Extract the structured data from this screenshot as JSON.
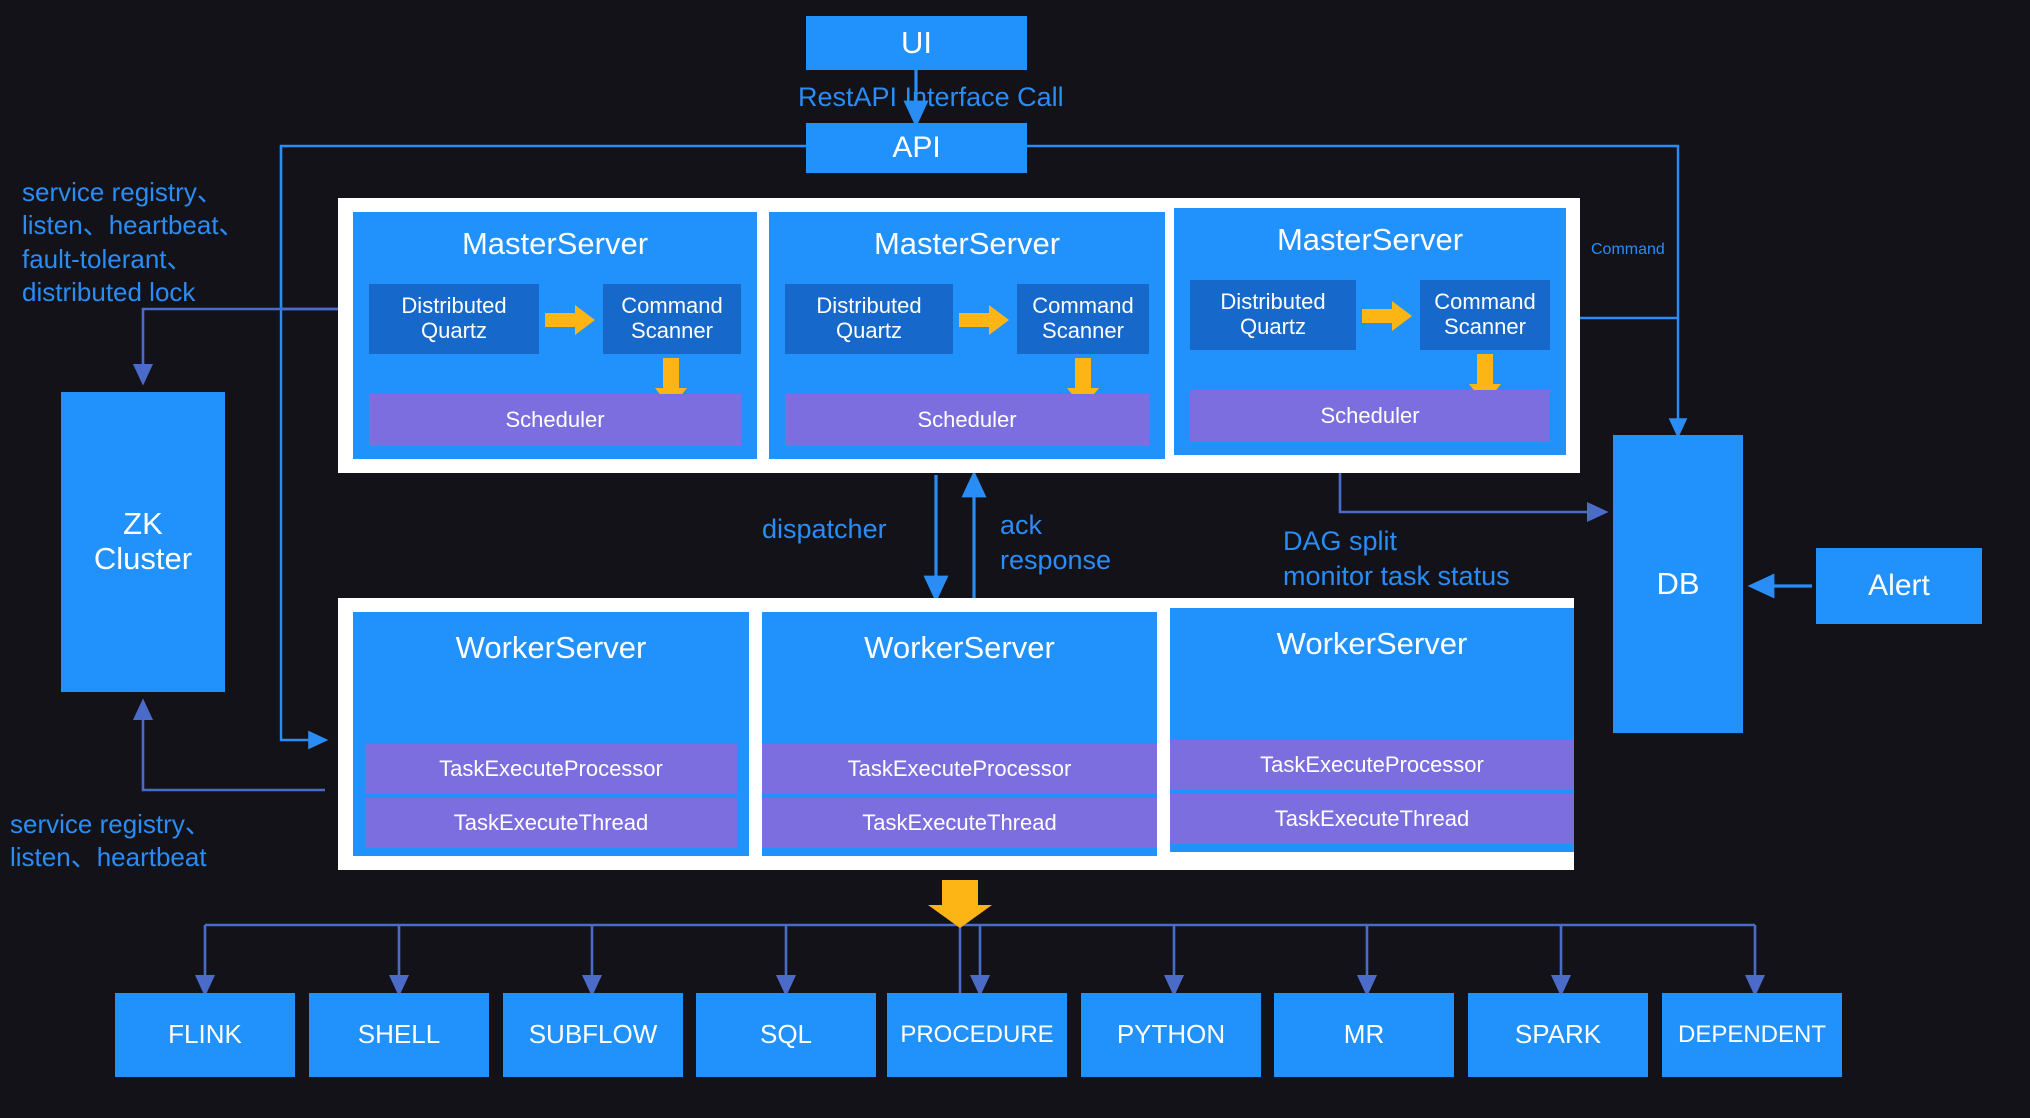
{
  "colors": {
    "background": "#121218",
    "box_blue": "#2191fb",
    "sub_blue": "#1668ca",
    "purple": "#7c6ede",
    "orange": "#fdb515",
    "wire_blue": "#2a8cf5",
    "wire_slate": "#4a6bc8",
    "frame_white": "#ffffff",
    "text_white": "#ffffff"
  },
  "nodes": {
    "ui": "UI",
    "api": "API",
    "db": "DB",
    "alert": "Alert",
    "zk_cluster": "ZK\nCluster"
  },
  "edge_labels": {
    "restapi": "RestAPI Interface Call",
    "command": "Command",
    "dispatcher": "dispatcher",
    "ack_response": "ack\nresponse",
    "dag_split": "DAG split\nmonitor task status",
    "zk_master": "service registry、\nlisten、heartbeat、\nfault-tolerant、\ndistributed lock",
    "zk_worker": "service registry、\nlisten、heartbeat"
  },
  "master_servers": [
    {
      "title": "MasterServer",
      "quartz": "Distributed\nQuartz",
      "scanner": "Command\nScanner",
      "scheduler": "Scheduler"
    },
    {
      "title": "MasterServer",
      "quartz": "Distributed\nQuartz",
      "scanner": "Command\nScanner",
      "scheduler": "Scheduler"
    },
    {
      "title": "MasterServer",
      "quartz": "Distributed\nQuartz",
      "scanner": "Command\nScanner",
      "scheduler": "Scheduler"
    }
  ],
  "worker_servers": [
    {
      "title": "WorkerServer",
      "processor": "TaskExecuteProcessor",
      "thread": "TaskExecuteThread"
    },
    {
      "title": "WorkerServer",
      "processor": "TaskExecuteProcessor",
      "thread": "TaskExecuteThread"
    },
    {
      "title": "WorkerServer",
      "processor": "TaskExecuteProcessor",
      "thread": "TaskExecuteThread"
    }
  ],
  "task_types": [
    "FLINK",
    "SHELL",
    "SUBFLOW",
    "SQL",
    "PROCEDURE",
    "PYTHON",
    "MR",
    "SPARK",
    "DEPENDENT"
  ]
}
